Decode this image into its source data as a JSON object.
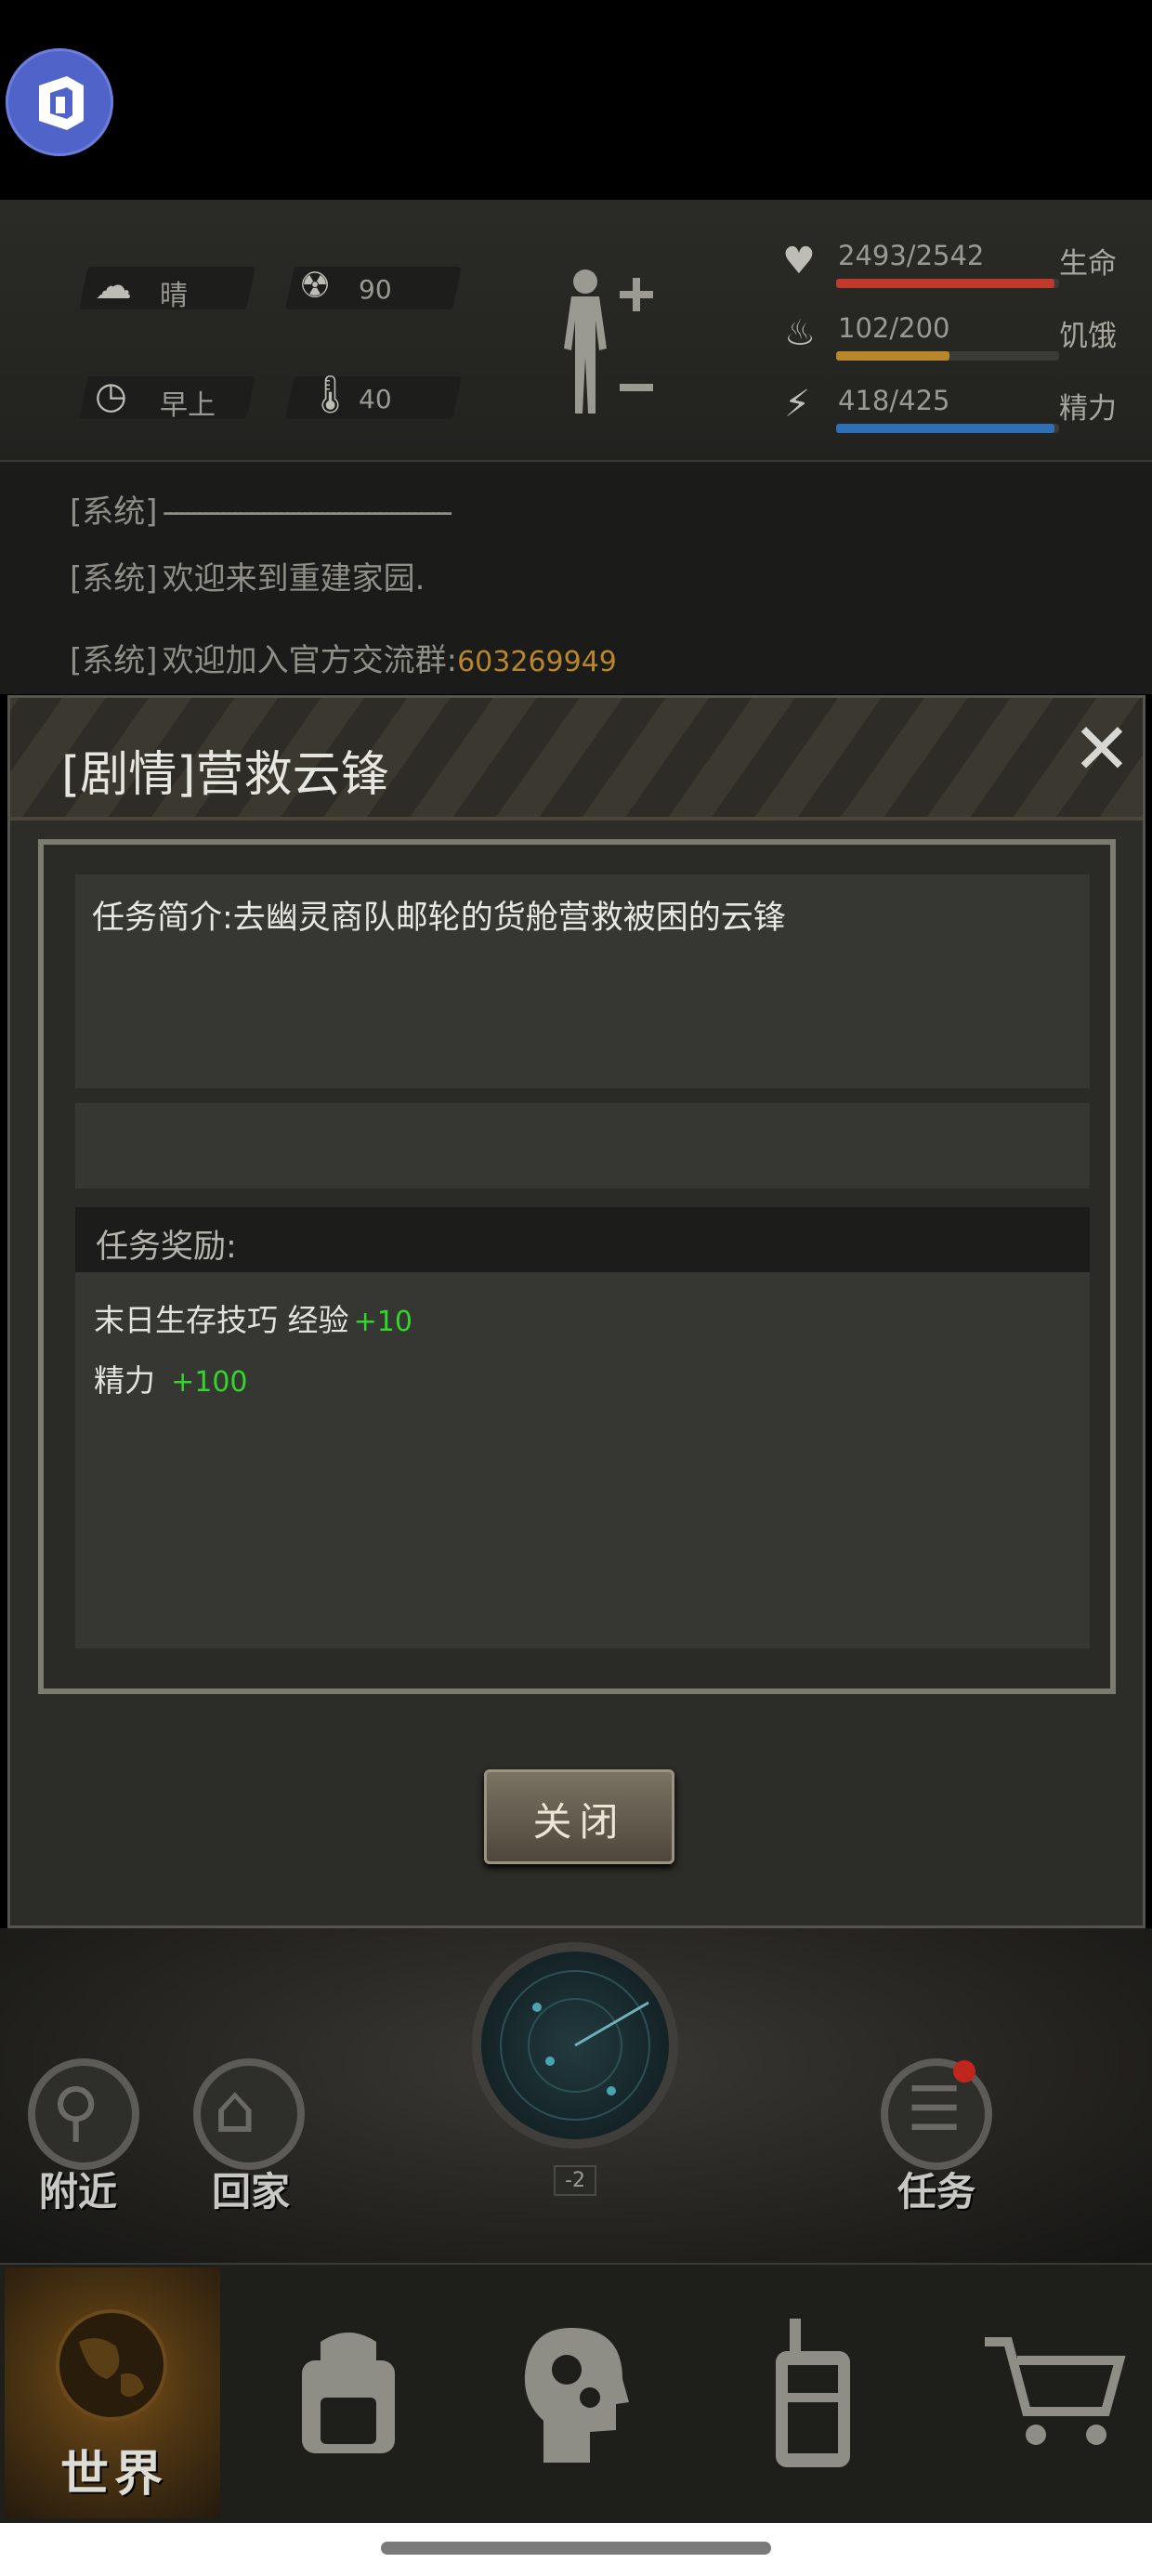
{
  "status": {
    "weather": "晴",
    "radiation": "90",
    "time_of_day": "早上",
    "temperature": "40",
    "stats": [
      {
        "label": "生命",
        "value": "2493/2542",
        "fraction": 0.98,
        "color": "#c0392b",
        "icon": "heart-icon"
      },
      {
        "label": "饥饿",
        "value": "102/200",
        "fraction": 0.51,
        "color": "#b8862b",
        "icon": "stomach-icon"
      },
      {
        "label": "精力",
        "value": "418/425",
        "fraction": 0.98,
        "color": "#2f6fb5",
        "icon": "energy-icon"
      }
    ]
  },
  "log": {
    "lines": [
      {
        "tag": "[系统]",
        "text": "-------------------------------------------------"
      },
      {
        "tag": "[系统]",
        "text": "欢迎来到重建家园."
      },
      {
        "tag": "[系统]",
        "text": "欢迎加入官方交流群:",
        "highlight": "603269949"
      }
    ]
  },
  "dialog": {
    "title": "[剧情]营救云锋",
    "close_symbol": "✕",
    "intro": "任务简介:去幽灵商队邮轮的货舱营救被困的云锋",
    "rewards_title": "任务奖励:",
    "rewards": [
      {
        "name": "末日生存技巧 经验",
        "value": "+10"
      },
      {
        "name": "精力",
        "value": "+100"
      }
    ],
    "close_button": "关闭"
  },
  "scene": {
    "nearby": "附近",
    "home": "回家",
    "tasks": "任务",
    "radar_level": "-2"
  },
  "nav": {
    "world": "世界"
  }
}
